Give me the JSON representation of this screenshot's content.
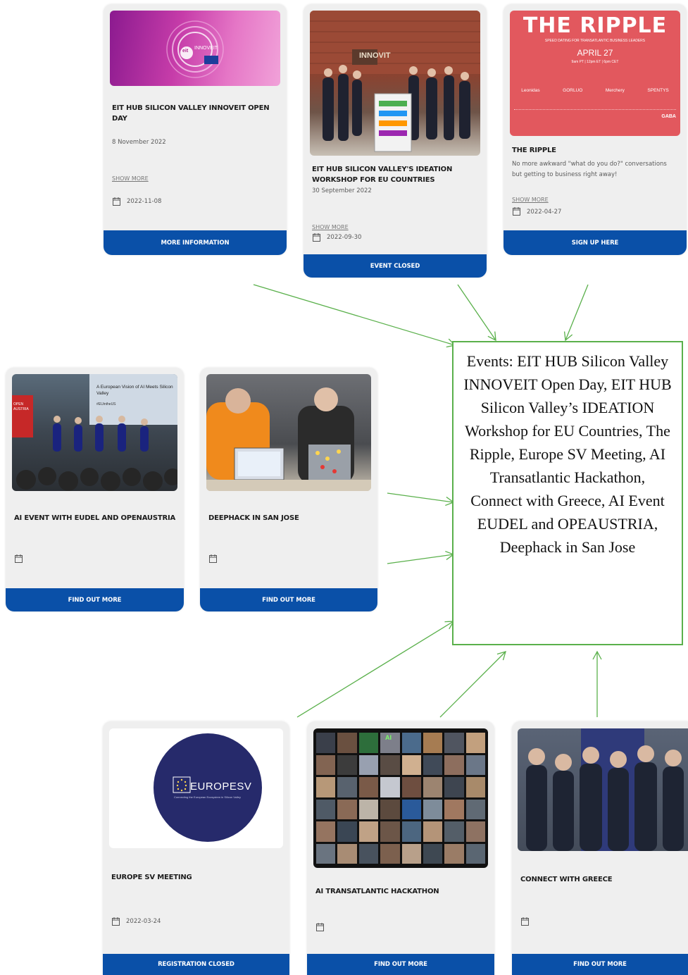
{
  "cards": {
    "innoveit": {
      "title": "EIT HUB SILICON VALLEY INNOVEIT OPEN DAY",
      "desc": "8 November 2022",
      "show_more": "SHOW MORE",
      "date": "2022-11-08",
      "button": "MORE INFORMATION",
      "logo_text": "INNOVEIT",
      "logo_small": "eit"
    },
    "ideation": {
      "title": "EIT HUB SILICON VALLEY'S IDEATION WORKSHOP FOR EU COUNTRIES",
      "desc": "30 September 2022",
      "show_more": "SHOW MORE",
      "date": "2022-09-30",
      "button": "EVENT CLOSED",
      "sign_text": "INNOVIT"
    },
    "ripple": {
      "title": "THE RIPPLE",
      "desc": "No more awkward \"what do you do?\" conversations but getting to business right away!",
      "show_more": "SHOW MORE",
      "date": "2022-04-27",
      "button": "SIGN UP HERE",
      "poster_title": "THE RIPPLE",
      "poster_sub": "SPEED DATING FOR TRANSATLANTIC BUSINESS LEADERS",
      "poster_date": "APRIL 27",
      "poster_time": "9am PT | 12pm ET | 6pm CET",
      "poster_sponsors": [
        "Leonidas",
        "GORLUO",
        "Merchery",
        "SPENTYS"
      ],
      "poster_badge": "GABA"
    },
    "ai_event": {
      "title": "AI EVENT WITH EUDEL AND OPENAUSTRIA",
      "button": "FIND OUT MORE",
      "banner_text": "A European Vision of AI Meets Silicon Valley",
      "banner_tag": "#EUintheUS",
      "side_banner": "OPEN AUSTRIA"
    },
    "deephack": {
      "title": "DEEPHACK IN SAN JOSE",
      "button": "FIND OUT MORE"
    },
    "europe_sv": {
      "title": "EUROPE SV MEETING",
      "date": "2022-03-24",
      "button": "REGISTRATION CLOSED",
      "logo_text": "EUROPESV",
      "logo_sub": "Connecting the European Ecosystem in Silicon Valley"
    },
    "hackathon": {
      "title": "AI TRANSATLANTIC HACKATHON",
      "button": "FIND OUT MORE",
      "screen_tag": "AI"
    },
    "greece": {
      "title": "CONNECT WITH GREECE",
      "button": "FIND OUT MORE"
    }
  },
  "summary": "Events: EIT HUB Silicon Valley INNOVEIT Open Day, EIT HUB Silicon Valley’s IDEATION Workshop for EU Countries, The Ripple, Europe SV Meeting, AI Transatlantic Hackathon, Connect with Greece, AI Event EUDEL and OPEAUSTRIA, Deephack in San Jose",
  "colors": {
    "button_blue": "#0a50a8",
    "arrow_green": "#5ab04b",
    "ripple_red": "#e2585e",
    "europesv_navy": "#262a6b"
  }
}
